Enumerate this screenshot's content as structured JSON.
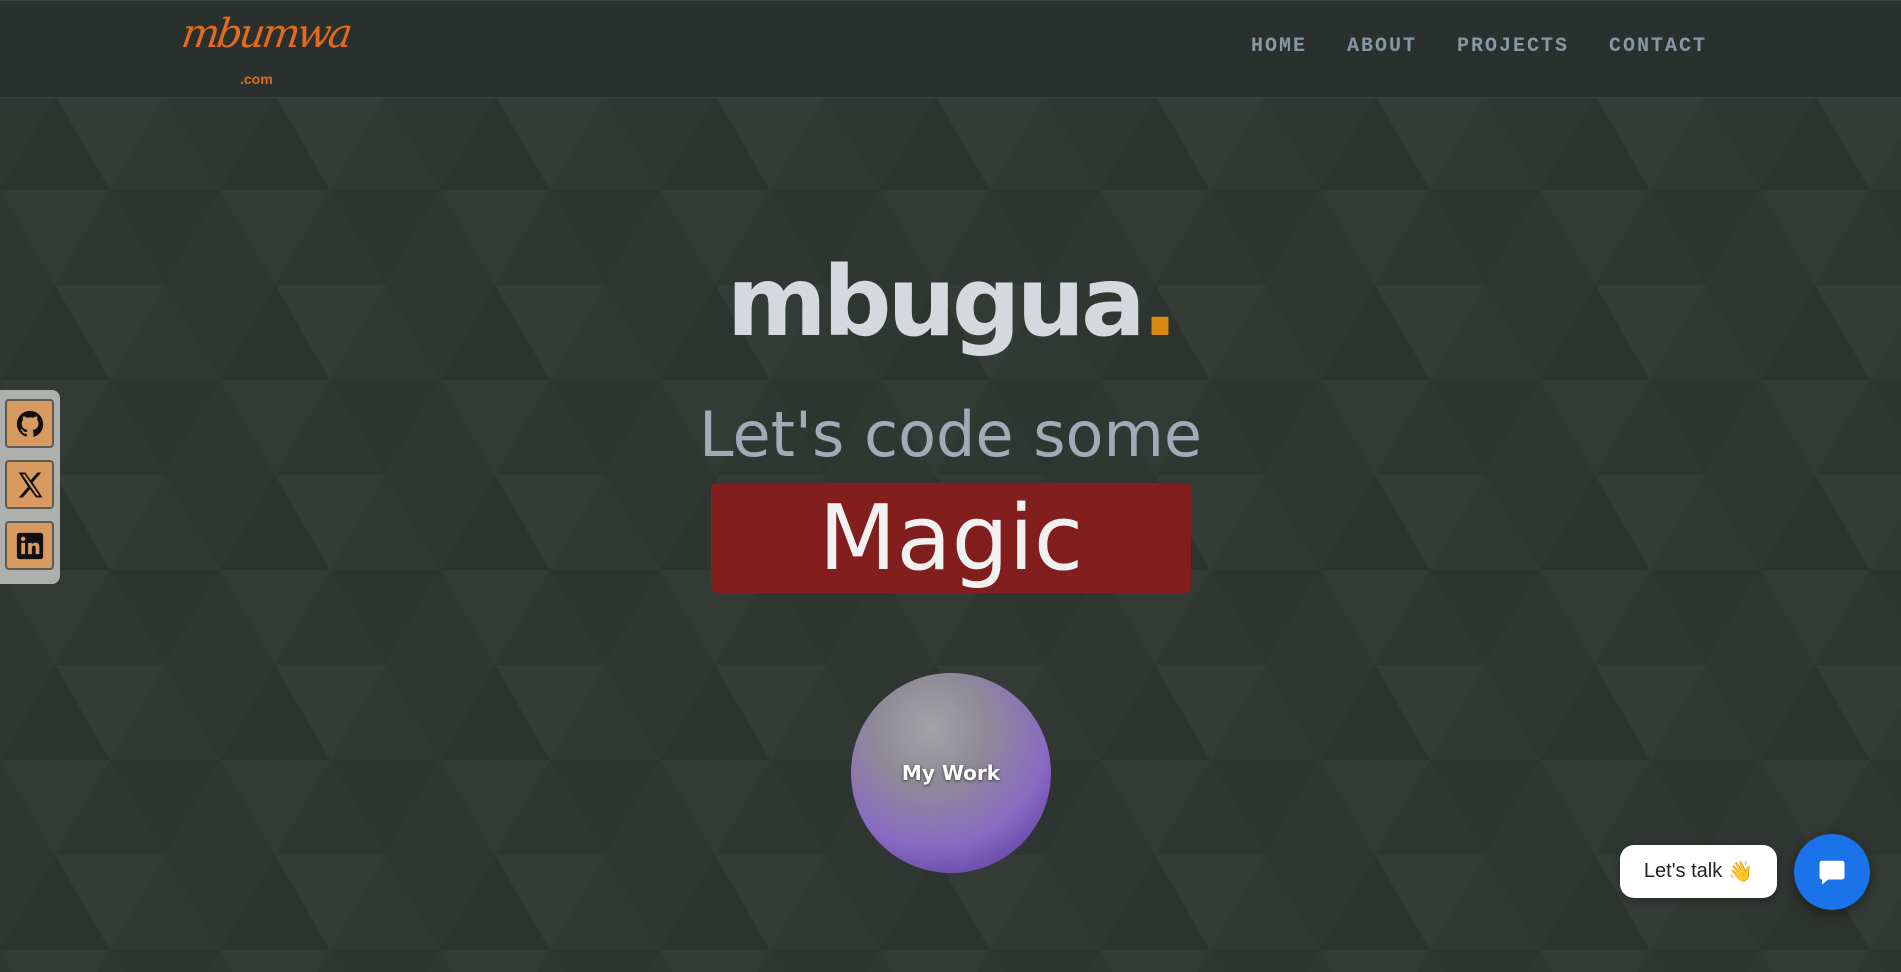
{
  "brand": {
    "logo_script": "mbumwa",
    "logo_tld": ".com"
  },
  "nav": {
    "items": [
      "HOME",
      "ABOUT",
      "PROJECTS",
      "CONTACT"
    ]
  },
  "hero": {
    "title": "mbugua",
    "title_dot": ".",
    "subtitle": "Let's code some",
    "highlight": "Magic",
    "cta": "My Work"
  },
  "social": [
    {
      "name": "github-icon"
    },
    {
      "name": "x-icon"
    },
    {
      "name": "linkedin-icon"
    }
  ],
  "chat": {
    "bubble_text": "Let's talk",
    "bubble_emoji": "👋",
    "icon": "chat-icon"
  },
  "colors": {
    "background": "#2f3530",
    "header": "#2a302d",
    "accent_orange": "#e36a1c",
    "title_dot": "#d68a14",
    "magic_box": "#821e1e",
    "social_button": "#d99a62",
    "chat_button": "#1a73e8",
    "nav_text": "#8897a4"
  }
}
